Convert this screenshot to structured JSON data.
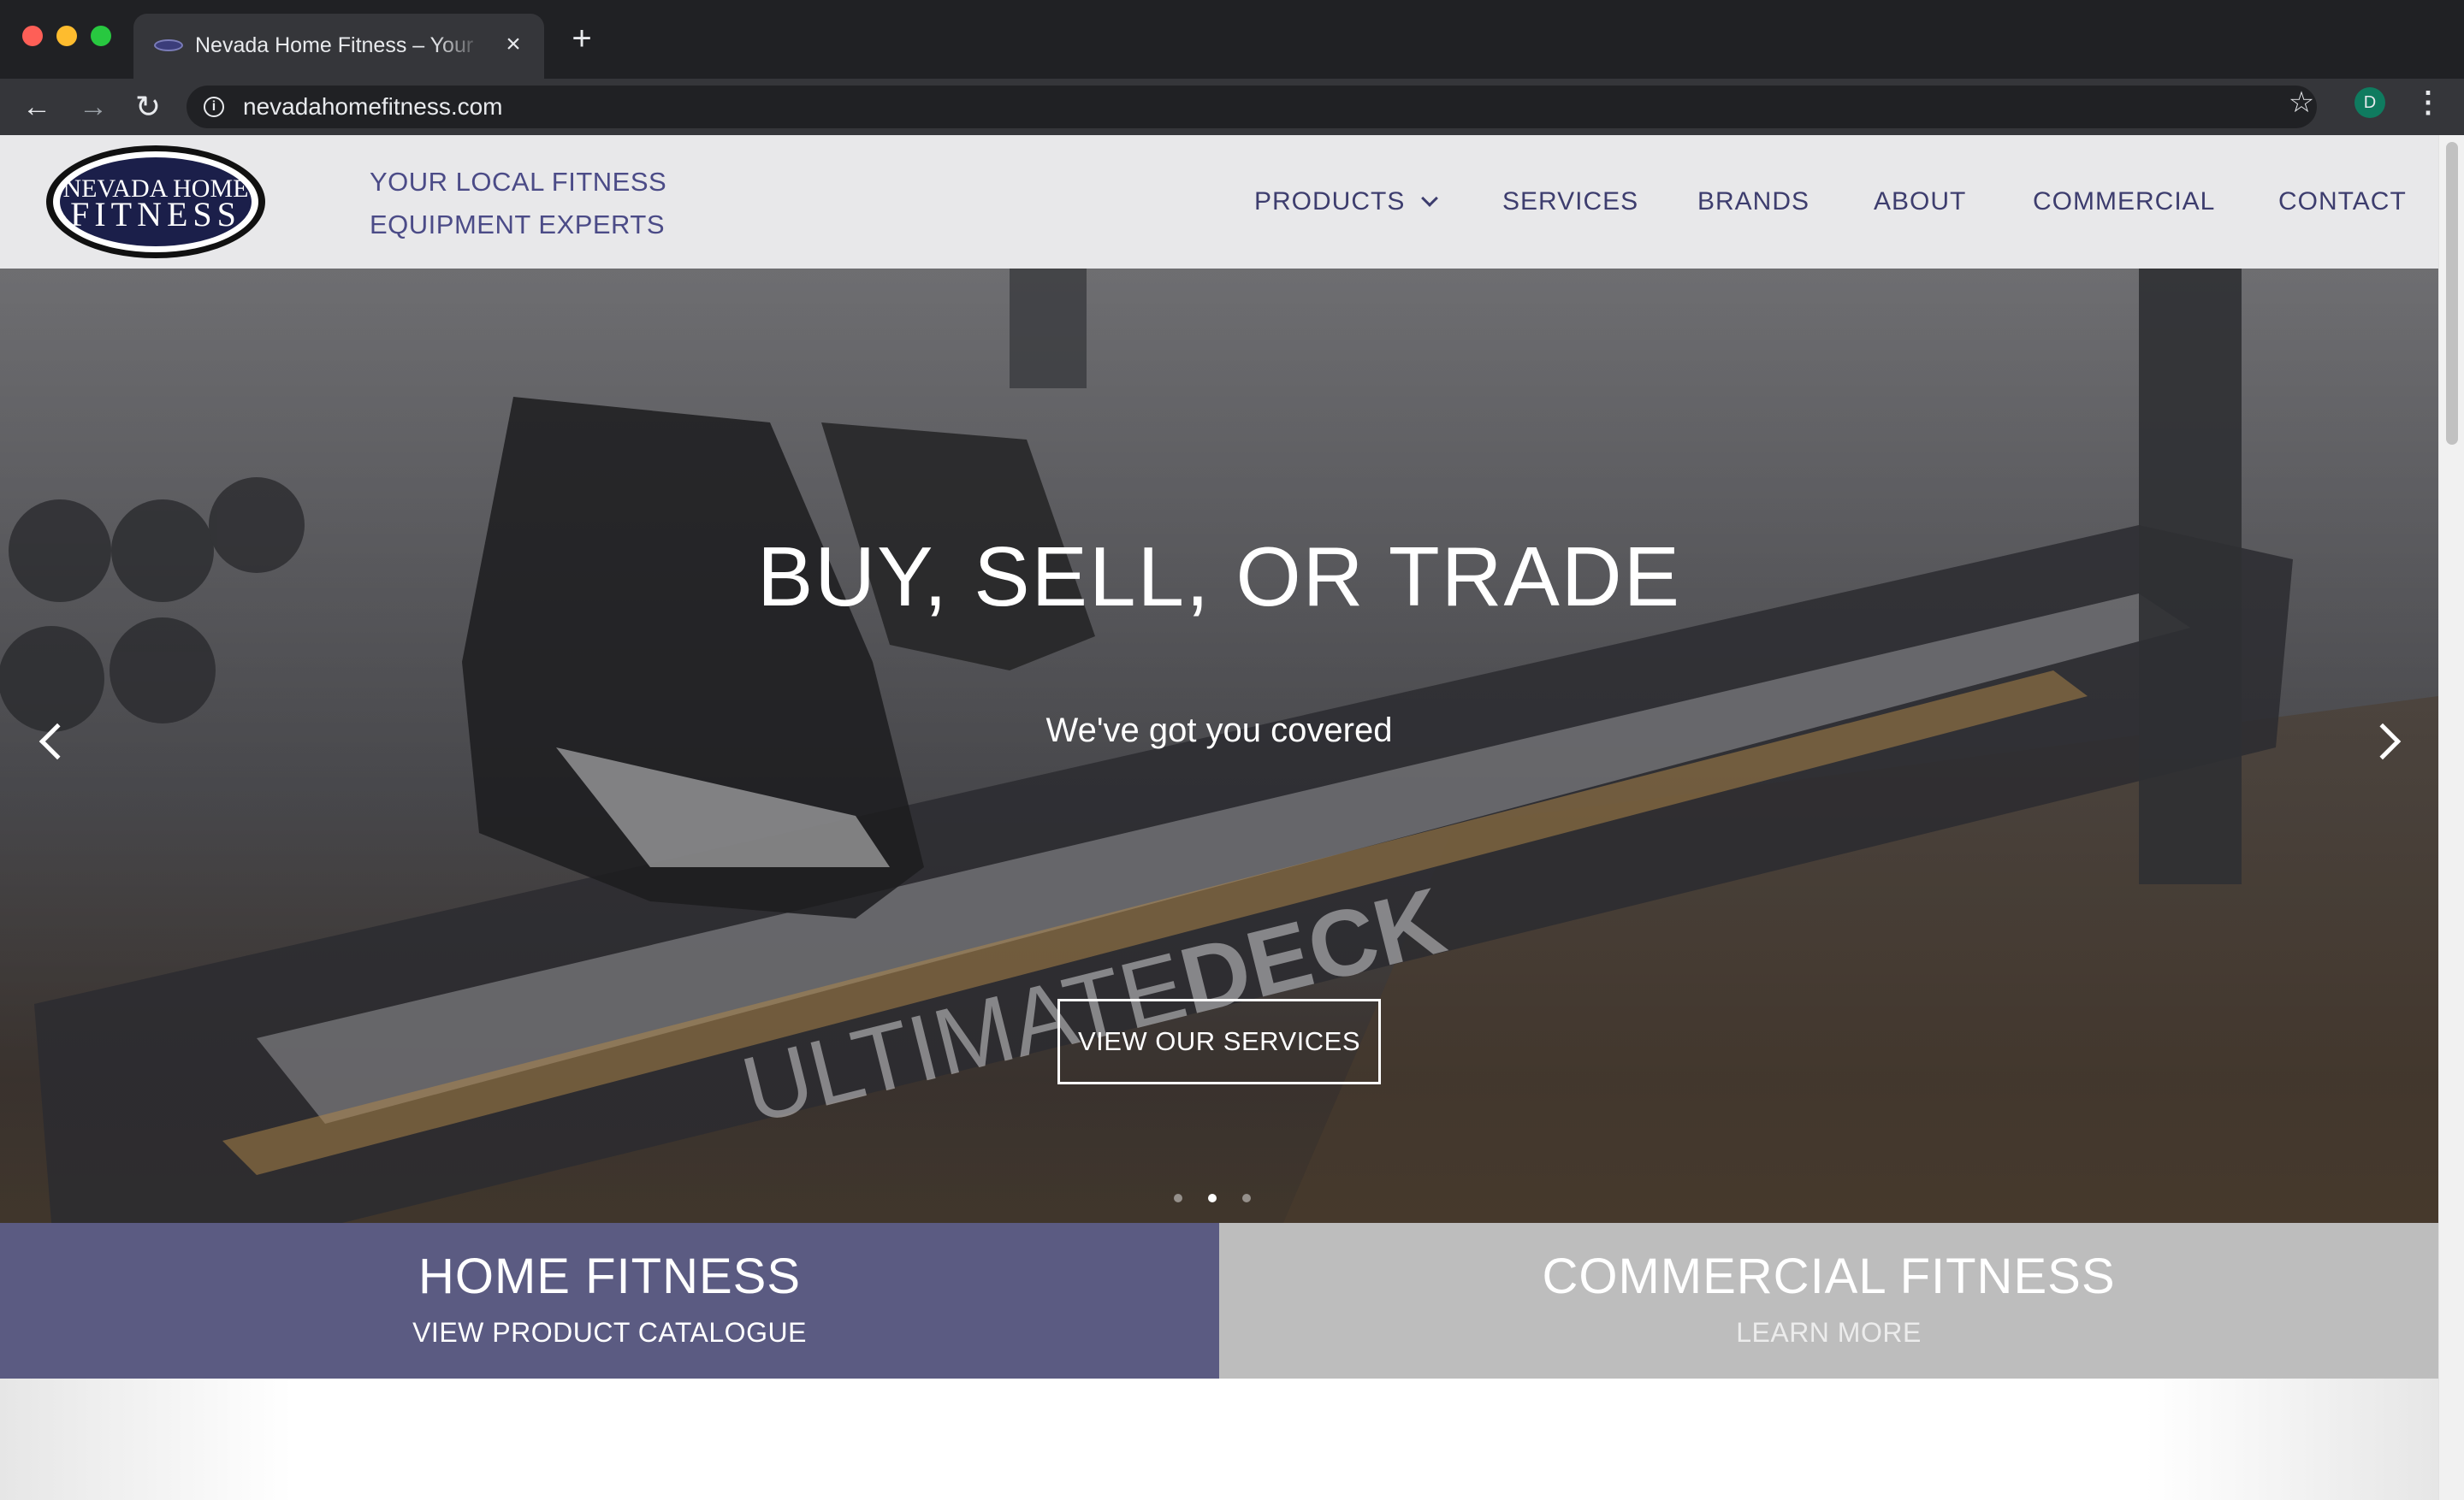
{
  "browser": {
    "tab_title": "Nevada Home Fitness – Your Local Fitness Equipment Experts",
    "tab_close": "×",
    "new_tab": "+",
    "url": "nevadahomefitness.com",
    "profile_initial": "D"
  },
  "header": {
    "logo_line1": "NEVADA HOME",
    "logo_line2": "FITNESS",
    "tagline_line1": "YOUR LOCAL FITNESS",
    "tagline_line2": "EQUIPMENT EXPERTS",
    "nav": {
      "products": "PRODUCTS",
      "services": "SERVICES",
      "brands": "BRANDS",
      "about": "ABOUT",
      "commercial": "COMMERCIAL",
      "contact": "CONTACT"
    }
  },
  "hero": {
    "title": "BUY, SELL, OR TRADE",
    "subtitle": "We've got you covered",
    "button": "VIEW OUR SERVICES",
    "deck_text_light": "ULTIMATE",
    "deck_text_bold": "DECK",
    "slide_count": 3,
    "active_slide": 2
  },
  "panels": {
    "home_title": "HOME FITNESS",
    "home_link": "VIEW PRODUCT CATALOGUE",
    "commercial_title": "COMMERCIAL FITNESS",
    "commercial_link": "LEARN MORE"
  },
  "colors": {
    "brand_purple": "#5b5b82",
    "nav_text": "#3d3d6e",
    "commercial_panel": "#bdbdbd"
  }
}
